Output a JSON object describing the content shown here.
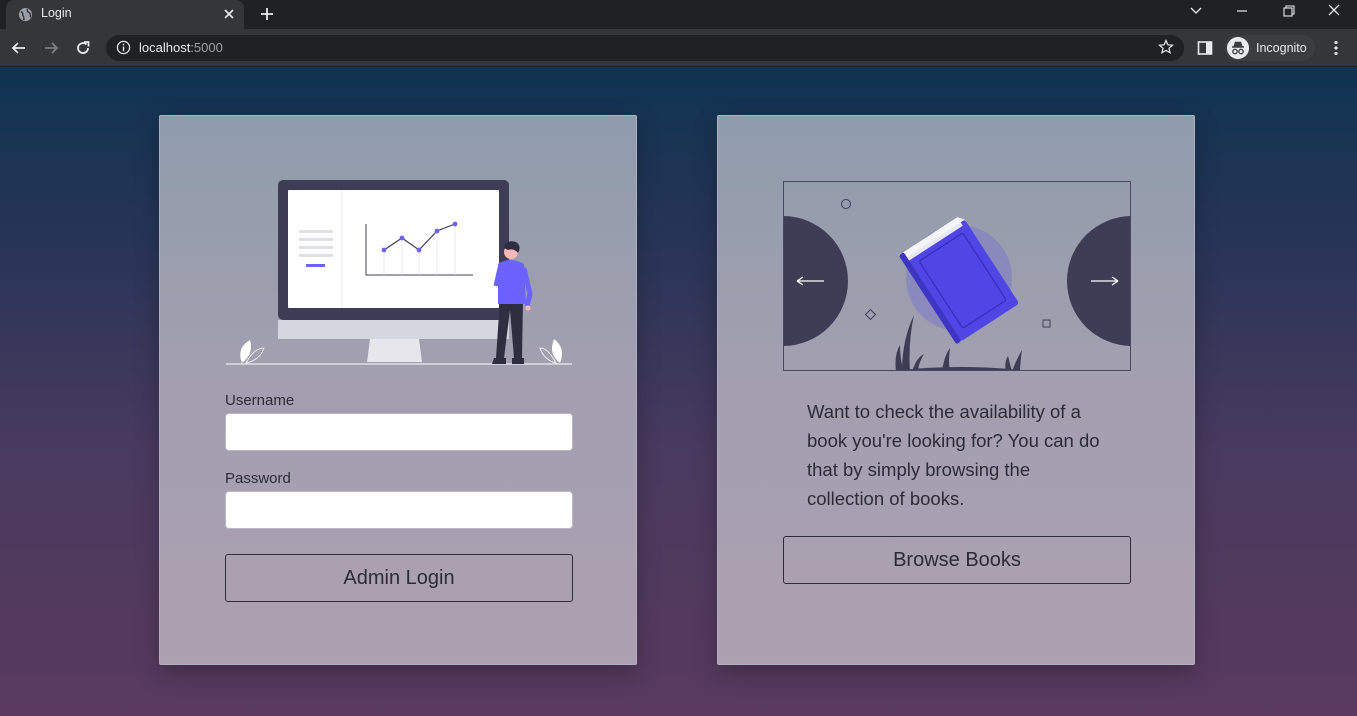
{
  "browser": {
    "tab_title": "Login",
    "url_host": "localhost",
    "url_port": ":5000",
    "profile_label": "Incognito"
  },
  "login_card": {
    "username_label": "Username",
    "username_value": "",
    "password_label": "Password",
    "password_value": "",
    "submit_label": "Admin Login"
  },
  "browse_card": {
    "description": "Want to check the availability of a book you're looking for? You can do that by simply browsing the collection of books.",
    "button_label": "Browse Books"
  },
  "colors": {
    "accent": "#6c63ff",
    "book_blue": "#4f46e5",
    "dark": "#3f3d56"
  },
  "icons": [
    "globe-icon",
    "close-icon",
    "plus-icon",
    "chevron-down-icon",
    "minimize-icon",
    "restore-icon",
    "close-window-icon",
    "back-arrow-icon",
    "forward-arrow-icon",
    "reload-icon",
    "info-icon",
    "star-icon",
    "side-panel-icon",
    "incognito-icon",
    "menu-dots-icon",
    "arrow-left-icon",
    "arrow-right-icon"
  ]
}
